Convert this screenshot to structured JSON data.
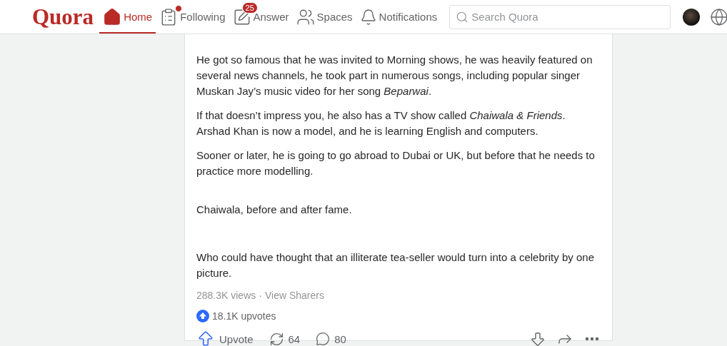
{
  "header": {
    "logo": "Quora",
    "nav": [
      {
        "kind": "home",
        "label": "Home",
        "selected": true
      },
      {
        "kind": "following",
        "label": "Following",
        "selected": false,
        "dot": true
      },
      {
        "kind": "answer",
        "label": "Answer",
        "selected": false,
        "badge": "25"
      },
      {
        "kind": "spaces",
        "label": "Spaces",
        "selected": false
      },
      {
        "kind": "notifications",
        "label": "Notifications",
        "selected": false
      }
    ],
    "search": {
      "placeholder": "Search Quora"
    }
  },
  "answer": {
    "paragraphs": [
      {
        "kind": "text",
        "text": "He got so famous that he was invited to Morning shows, he was heavily featured on several news channels, he took part in numerous songs, including popular singer Muskan Jay’s music video for her song *Beparwai*."
      },
      {
        "kind": "text",
        "text": "If that doesn’t impress you, he also has a TV show called *Chaiwala & Friends*. Arshad Khan is now a model, and he is learning English and computers."
      },
      {
        "kind": "text",
        "text": "Sooner or later, he is going to go abroad to Dubai or UK, but before that he needs to practice more modelling."
      },
      {
        "kind": "caption",
        "text": "Chaiwala, before and after fame."
      },
      {
        "kind": "text",
        "text": "Who could have thought that an illiterate tea-seller would turn into a celebrity by one picture."
      }
    ],
    "views": "288.3K views",
    "separator": "·",
    "view_sharers": "View Sharers",
    "upvotes": "18.1K upvotes",
    "actions": {
      "upvote": "Upvote",
      "shares": "64",
      "comments": "80"
    }
  }
}
